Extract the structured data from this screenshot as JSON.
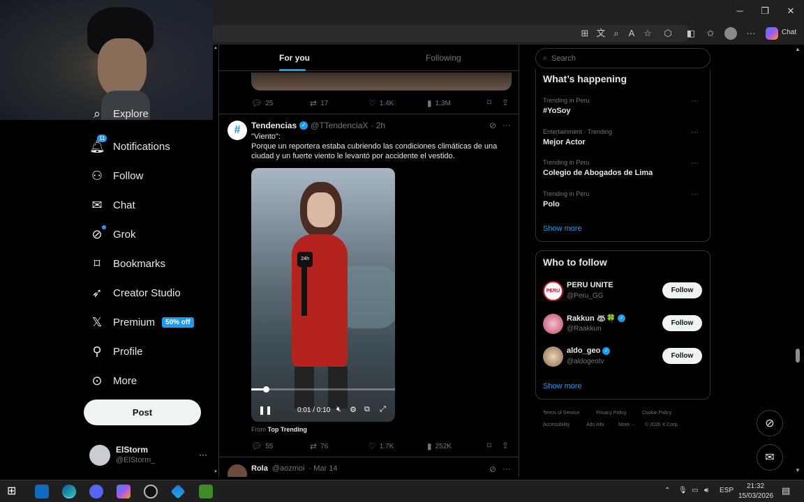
{
  "browser": {
    "chat_label": "Chat",
    "win_min": "─",
    "win_max": "❐",
    "win_close": "✕"
  },
  "nav": {
    "explore": "Explore",
    "notifications": "Notifications",
    "notif_badge": "11",
    "follow": "Follow",
    "chat": "Chat",
    "grok": "Grok",
    "bookmarks": "Bookmarks",
    "creator_studio": "Creator Studio",
    "premium": "Premium",
    "premium_badge": "50% off",
    "profile": "Profile",
    "more": "More",
    "post_button": "Post",
    "account_name": "ElStorm",
    "account_handle": "@ElStorm_",
    "account_more": "···"
  },
  "tabs": {
    "for_you": "For you",
    "following": "Following"
  },
  "prev_tweet_actions": {
    "replies": "25",
    "reposts": "17",
    "likes": "1.4K",
    "views": "1.3M"
  },
  "tweet": {
    "author": "Tendencias",
    "handle": "@TTendenciaX",
    "time": "· 2h",
    "text_line1": "\"Viento\":",
    "text_line2": "Porque un reportera estaba cubriendo las condiciones climáticas de una ciudad y un fuerte viento le levantó por accidente el vestido.",
    "video_time": "0:01 / 0:10",
    "from_prefix": "From",
    "from_source": "Top Trending",
    "replies": "55",
    "reposts": "76",
    "likes": "1.7K",
    "views": "252K",
    "mic_logo": "24h",
    "video_progress": 0.1
  },
  "next_tweet": {
    "author": "Rola",
    "handle": "@aozmoi",
    "time": "· Mar 14"
  },
  "search": {
    "placeholder": "Search"
  },
  "whats_happening": {
    "title": "What’s happening",
    "trends": [
      {
        "meta": "Trending in Peru",
        "name": "#YoSoy"
      },
      {
        "meta": "Entertainment · Trending",
        "name": "Mejor Actor"
      },
      {
        "meta": "Trending in Peru",
        "name": "Colegio de Abogados de Lima"
      },
      {
        "meta": "Trending in Peru",
        "name": "Polo"
      }
    ],
    "show_more": "Show more"
  },
  "who_to_follow": {
    "title": "Who to follow",
    "accounts": [
      {
        "name": "PERU UNITE",
        "handle": "@Peru_GG",
        "button": "Follow",
        "avatar_text": "PERU"
      },
      {
        "name": "Rakkun 🦝🍀",
        "handle": "@Raakkun",
        "button": "Follow"
      },
      {
        "name": "aldo_geo",
        "handle": "@aldogeotv",
        "button": "Follow"
      }
    ],
    "show_more": "Show more"
  },
  "footer": {
    "terms": "Terms of Service",
    "privacy": "Privacy Policy",
    "cookie": "Cookie Policy",
    "accessibility": "Accessibility",
    "ads": "Ads info",
    "more": "More ···",
    "copyright": "© 2026 X Corp."
  },
  "taskbar": {
    "lang": "ESP",
    "time": "21:32",
    "date": "15/03/2026"
  },
  "colors": {
    "accent": "#1d9bf0",
    "bg": "#000000",
    "border": "#2f3336",
    "muted": "#71767b"
  }
}
